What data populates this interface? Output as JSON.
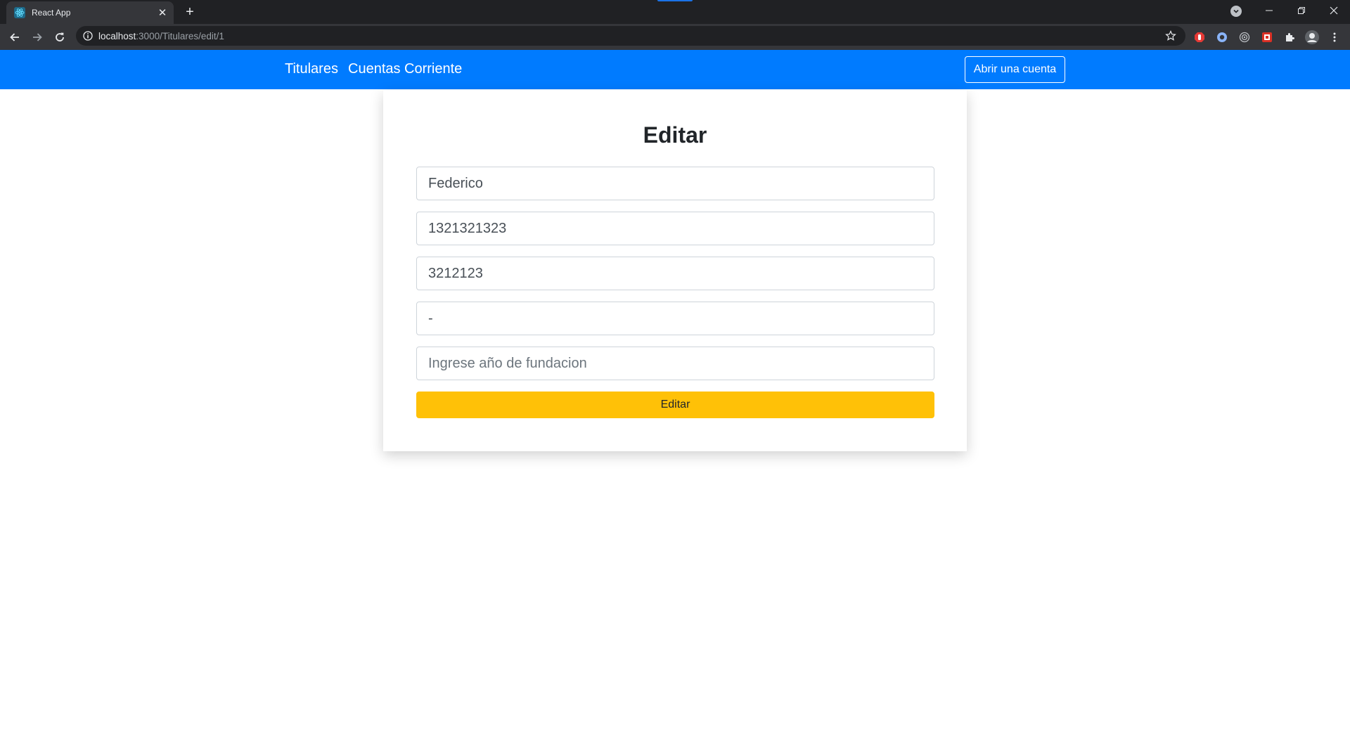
{
  "browser": {
    "tab_title": "React App",
    "tab_close_glyph": "✕",
    "new_tab_glyph": "+",
    "url_host": "localhost",
    "url_rest": ":3000/Titulares/edit/1",
    "window": {
      "minimize": "—",
      "restore": "❐",
      "close": "✕"
    }
  },
  "navbar": {
    "links": [
      "Titulares",
      "Cuentas Corriente"
    ],
    "action_button": "Abrir una cuenta",
    "background": "#007bff"
  },
  "form": {
    "title": "Editar",
    "fields": [
      {
        "value": "Federico",
        "placeholder": ""
      },
      {
        "value": "1321321323",
        "placeholder": ""
      },
      {
        "value": "3212123",
        "placeholder": ""
      },
      {
        "value": "-",
        "placeholder": ""
      },
      {
        "value": "",
        "placeholder": "Ingrese año de fundacion"
      }
    ],
    "submit_label": "Editar",
    "submit_color": "#ffc107"
  },
  "icons": {
    "favicon": "react-icon",
    "back": "arrow-left-icon",
    "forward": "arrow-right-icon",
    "reload": "reload-icon",
    "info": "info-icon",
    "bookmark": "star-icon",
    "extensions": [
      "adblock-icon",
      "extension-circle-icon",
      "target-icon",
      "red-extension-icon",
      "puzzle-icon",
      "profile-icon",
      "kebab-menu-icon"
    ]
  }
}
